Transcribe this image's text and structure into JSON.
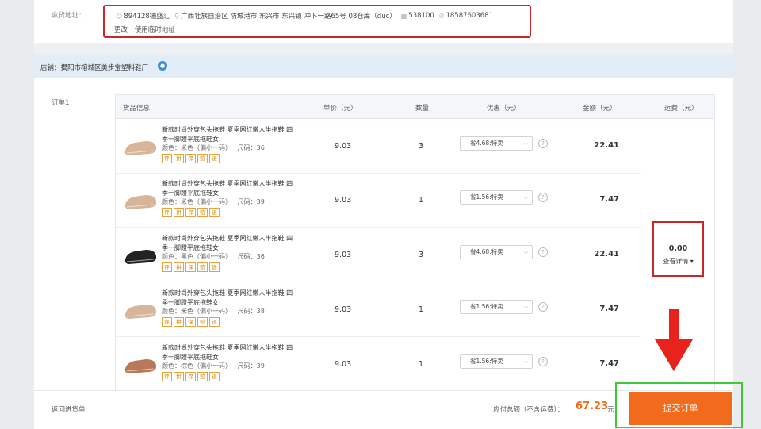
{
  "address": {
    "label": "收货地址：",
    "name": "894128德盛汇",
    "location": "广西壮族自治区 防城港市 东兴市 东兴镇 冲卜一路65号 08仓库（duc）",
    "postcode": "538100",
    "phone": "18587603681",
    "links": [
      "更改",
      "使用临时地址"
    ]
  },
  "store": {
    "name": "店铺：揭阳市榕城区美步宝塑料鞋厂"
  },
  "order": {
    "label": "订单1：",
    "headers": [
      "货品信息",
      "单价（元）",
      "数量",
      "优惠（元）",
      "金额（元）",
      "运费（元）"
    ],
    "badges": [
      "评",
      "拼",
      "保",
      "赔",
      "退"
    ],
    "items": [
      {
        "name": "新款时尚外穿包头拖鞋 夏季网红懒人半拖鞋 四季一脚蹬平底拖鞋女",
        "color": "颜色：米色（偏小一码）",
        "size": "尺码：36",
        "price": "9.03",
        "qty": "3",
        "discount": "省4.68:特卖",
        "amount": "22.41",
        "shoe_color": "#d6b59a"
      },
      {
        "name": "新款时尚外穿包头拖鞋 夏季网红懒人半拖鞋 四季一脚蹬平底拖鞋女",
        "color": "颜色：米色（偏小一码）",
        "size": "尺码：39",
        "price": "9.03",
        "qty": "1",
        "discount": "省1.56:特卖",
        "amount": "7.47",
        "shoe_color": "#d6b59a"
      },
      {
        "name": "新款时尚外穿包头拖鞋 夏季网红懒人半拖鞋 四季一脚蹬平底拖鞋女",
        "color": "颜色：黑色（偏小一码）",
        "size": "尺码：36",
        "price": "9.03",
        "qty": "3",
        "discount": "省4.68:特卖",
        "amount": "22.41",
        "shoe_color": "#222222"
      },
      {
        "name": "新款时尚外穿包头拖鞋 夏季网红懒人半拖鞋 四季一脚蹬平底拖鞋女",
        "color": "颜色：米色（偏小一码）",
        "size": "尺码：38",
        "price": "9.03",
        "qty": "1",
        "discount": "省1.56:特卖",
        "amount": "7.47",
        "shoe_color": "#d6b59a"
      },
      {
        "name": "新款时尚外穿包头拖鞋 夏季网红懒人半拖鞋 四季一脚蹬平底拖鞋女",
        "color": "颜色：棕色（偏小一码）",
        "size": "尺码：39",
        "price": "9.03",
        "qty": "1",
        "discount": "省1.56:特卖",
        "amount": "7.47",
        "shoe_color": "#b8795a"
      }
    ],
    "shipping": {
      "amount": "0.00",
      "detail": "查看详情 ▾"
    }
  },
  "footer": {
    "back": "返回进货单",
    "total_label": "应付总额（不含运费）：",
    "total": "67.23",
    "unit": "元",
    "submit": "提交订单"
  },
  "colors": {
    "accent": "#f26b1d",
    "highlight_red": "#c62828",
    "highlight_green": "#3cc93c"
  }
}
